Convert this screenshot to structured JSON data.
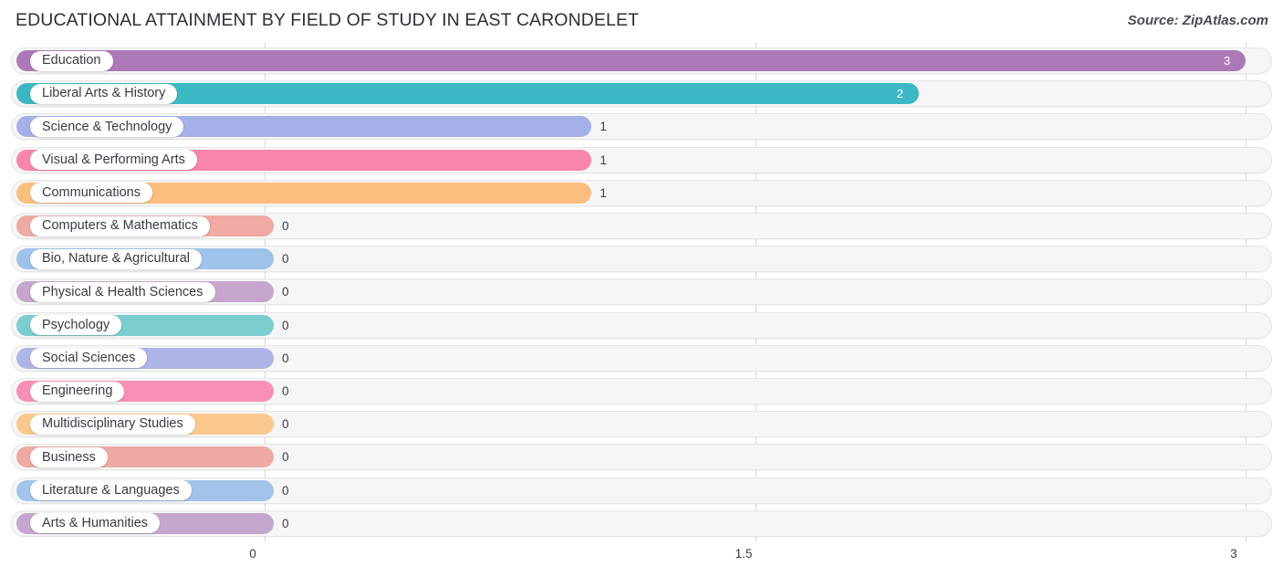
{
  "header": {
    "title": "EDUCATIONAL ATTAINMENT BY FIELD OF STUDY IN EAST CARONDELET",
    "source": "Source: ZipAtlas.com"
  },
  "chart_data": {
    "type": "bar",
    "orientation": "horizontal",
    "title": "EDUCATIONAL ATTAINMENT BY FIELD OF STUDY IN EAST CARONDELET",
    "xlabel": "",
    "ylabel": "",
    "xlim": [
      0,
      3
    ],
    "xticks": [
      "0",
      "1.5",
      "3"
    ],
    "xtick_values": [
      0,
      1.5,
      3
    ],
    "grid": true,
    "legend": false,
    "categories": [
      "Education",
      "Liberal Arts & History",
      "Science & Technology",
      "Visual & Performing Arts",
      "Communications",
      "Computers & Mathematics",
      "Bio, Nature & Agricultural",
      "Physical & Health Sciences",
      "Psychology",
      "Social Sciences",
      "Engineering",
      "Multidisciplinary Studies",
      "Business",
      "Literature & Languages",
      "Arts & Humanities"
    ],
    "values": [
      3,
      2,
      1,
      1,
      1,
      0,
      0,
      0,
      0,
      0,
      0,
      0,
      0,
      0,
      0
    ],
    "value_labels": [
      "3",
      "2",
      "1",
      "1",
      "1",
      "0",
      "0",
      "0",
      "0",
      "0",
      "0",
      "0",
      "0",
      "0",
      "0"
    ],
    "colors": [
      "#ac79b6",
      "#3cb8c4",
      "#a5afe8",
      "#f985ad",
      "#fbbe7e",
      "#f0a9a3",
      "#9ec2ea",
      "#c7a6cd",
      "#7bcdd0",
      "#adb6e6",
      "#f98fb6",
      "#fbc88d",
      "#eda9a2",
      "#a3c3ea",
      "#c4a7cf"
    ]
  }
}
